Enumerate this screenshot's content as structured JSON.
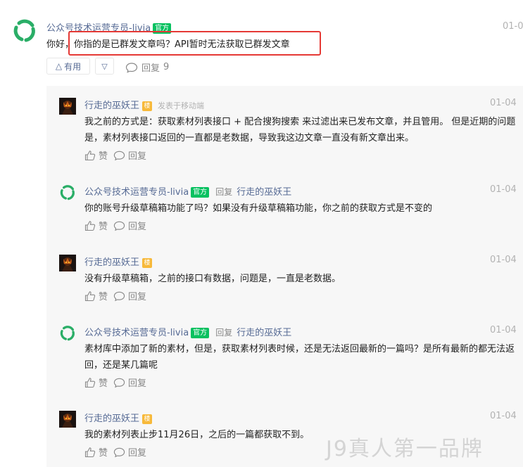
{
  "comment": {
    "author": "公众号技术运营专员-livia",
    "author_badge": "官方",
    "date": "01-0",
    "text_prefix": "你好，",
    "text_highlight": "你指的是已群发文章吗？API暂时无法获取已群发文章",
    "useful_label": "有用",
    "reply_label": "回复",
    "reply_count": "9"
  },
  "replies": [
    {
      "author": "行走的巫妖王",
      "badge": "楼",
      "meta": "发表于移动端",
      "date": "01-04",
      "text": "我之前的方式是：获取素材列表接口 + 配合搜狗搜索 来过滤出来已发布文章，并且管用。 但是近期的问题是，素材列表接口返回的一直都是老数据，导致我这边文章一直没有新文章出来。",
      "like_label": "赞",
      "reply_label": "回复"
    },
    {
      "author": "公众号技术运营专员-livia",
      "badge": "官方",
      "reply_word": "回复",
      "reply_target": "行走的巫妖王",
      "date": "01-04",
      "text": "你的账号升级草稿箱功能了吗？如果没有升级草稿箱功能，你之前的获取方式是不变的",
      "like_label": "赞",
      "reply_label": "回复"
    },
    {
      "author": "行走的巫妖王",
      "badge": "楼",
      "date": "01-04",
      "text": "没有升级草稿箱，之前的接口有数据，问题是，一直是老数据。",
      "like_label": "赞",
      "reply_label": "回复"
    },
    {
      "author": "公众号技术运营专员-livia",
      "badge": "官方",
      "reply_word": "回复",
      "reply_target": "行走的巫妖王",
      "date": "01-04",
      "text": "素材库中添加了新的素材，但是，获取素材列表时候，还是无法返回最新的一篇吗？是所有最新的都无法返回，还是某几篇呢",
      "like_label": "赞",
      "reply_label": "回复"
    },
    {
      "author": "行走的巫妖王",
      "badge": "楼",
      "date": "01-04",
      "text": "我的素材列表止步11月26日，之后的一篇都获取不到。",
      "like_label": "赞",
      "reply_label": "回复"
    }
  ],
  "watermark": "J9真人第一品牌",
  "colors": {
    "link": "#576b95",
    "official_badge": "#07c160",
    "author_badge": "#f7b93a",
    "highlight_border": "#e53935",
    "logo_green": "#2aae67"
  }
}
